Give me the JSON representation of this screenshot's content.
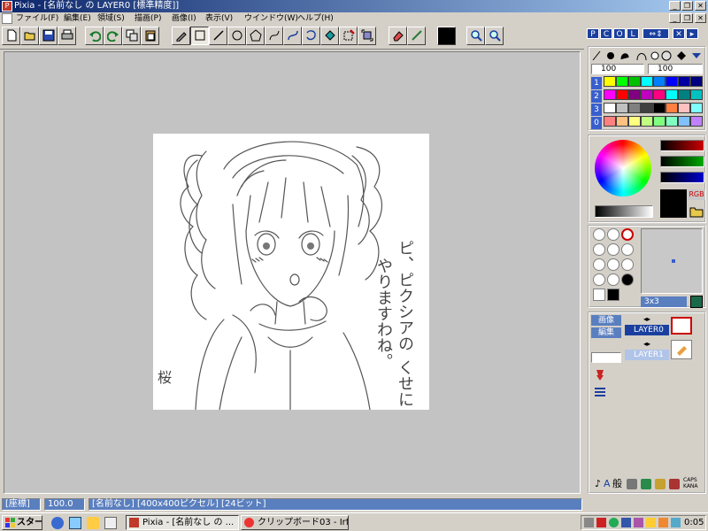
{
  "window": {
    "title": "Pixia - [名前なし の LAYER0 [標準精度]]",
    "controls": {
      "minimize": "_",
      "restore": "❐",
      "close": "✕"
    }
  },
  "menu": [
    "ファイル(F)",
    "編集(E)",
    "領域(S)",
    "描画(P)",
    "画像(I)",
    "表示(V)",
    "ウインドウ(W)",
    "ヘルプ(H)"
  ],
  "palette": {
    "tabs": [
      "P",
      "C",
      "O",
      "L"
    ],
    "brush_size": "100",
    "brush_density": "100",
    "layer_numbers": [
      "1",
      "2",
      "3",
      "0"
    ],
    "brush_size_label": "3x3",
    "rgb_label": "RGB",
    "layer_buttons": {
      "image": "画像",
      "edit": "編集"
    },
    "layers": [
      {
        "name": "LAYER0",
        "selected": true
      },
      {
        "name": "LAYER1",
        "selected": false
      }
    ],
    "bottom_text": "般",
    "caps": "CAPS",
    "kana": "KANA"
  },
  "swatch_colors": [
    [
      "#ffff00",
      "#00ff00",
      "#00c000",
      "#00ffff",
      "#0080ff",
      "#0000ff",
      "#0000a0",
      "#000080"
    ],
    [
      "#ff00ff",
      "#ff0000",
      "#800080",
      "#c000c0",
      "#ff0080",
      "#00ffff",
      "#008080",
      "#00c0c0"
    ],
    [
      "#ffffff",
      "#c0c0c0",
      "#808080",
      "#404040",
      "#000000",
      "#ff8040",
      "#ffc0c0",
      "#80ffff"
    ],
    [
      "#ff8080",
      "#ffc080",
      "#ffff80",
      "#c0ff80",
      "#80ff80",
      "#80ffc0",
      "#80c0ff",
      "#c080ff"
    ]
  ],
  "status": {
    "coords": "[座標]",
    "zoom": "100.0",
    "info": "[名前なし] [400x400ピクセル] [24ビット]"
  },
  "taskbar": {
    "start": "スタート",
    "tasks": [
      {
        "label": "Pixia - [名前なし の ...",
        "active": true
      },
      {
        "label": "クリップボード03 - IrfanView",
        "active": false
      }
    ],
    "clock": "0:05"
  },
  "canvas_text": {
    "line1": "ピ、ピクシアの",
    "line2": "くせに",
    "line3": "やりますわね。",
    "signature": "桜"
  },
  "colors": {
    "titlebar_start": "#0a246a",
    "titlebar_end": "#a6caf0",
    "canvas_bg": "#ffffff",
    "workspace_bg": "#c3c3c3",
    "status_bg": "#5a7fbf"
  }
}
